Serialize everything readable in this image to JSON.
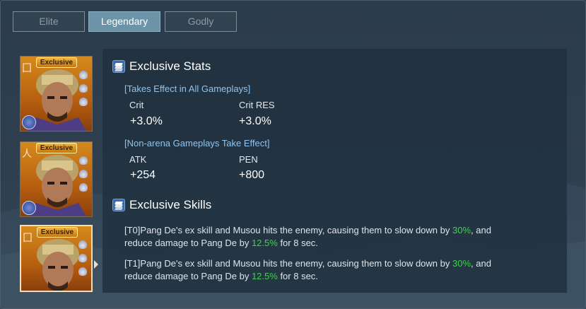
{
  "tabs": [
    {
      "label": "Elite",
      "active": false
    },
    {
      "label": "Legendary",
      "active": true
    },
    {
      "label": "Godly",
      "active": false
    }
  ],
  "portraits": [
    {
      "badge": "Exclusive",
      "selected": false
    },
    {
      "badge": "Exclusive",
      "selected": false
    },
    {
      "badge": "Exclusive",
      "selected": true
    }
  ],
  "stats_section": {
    "title": "Exclusive Stats",
    "groups": [
      {
        "header": "[Takes Effect in All Gameplays]",
        "stats": [
          {
            "name": "Crit",
            "value": "+3.0%"
          },
          {
            "name": "Crit RES",
            "value": "+3.0%"
          }
        ]
      },
      {
        "header": "[Non-arena Gameplays Take Effect]",
        "stats": [
          {
            "name": "ATK",
            "value": "+254"
          },
          {
            "name": "PEN",
            "value": "+800"
          }
        ]
      }
    ]
  },
  "skills_section": {
    "title": "Exclusive Skills",
    "skills": [
      {
        "line1_pre": "[T0]Pang De's ex skill and Musou hits the enemy, causing them to slow down by ",
        "slow_pct": "30%",
        "line1_post": ", and",
        "line2_pre": "reduce damage to Pang De by ",
        "reduce_pct": "12.5%",
        "line2_post": " for 8 sec."
      },
      {
        "line1_pre": "[T1]Pang De's ex skill and Musou hits the enemy, causing them to slow down by ",
        "slow_pct": "30%",
        "line1_post": ", and",
        "line2_pre": "reduce damage to Pang De by ",
        "reduce_pct": "12.5%",
        "line2_post": " for 8 sec."
      }
    ]
  },
  "colors": {
    "highlight": "#3ed24a",
    "group_header": "#8fc4f0",
    "active_tab": "#6c94a9"
  }
}
